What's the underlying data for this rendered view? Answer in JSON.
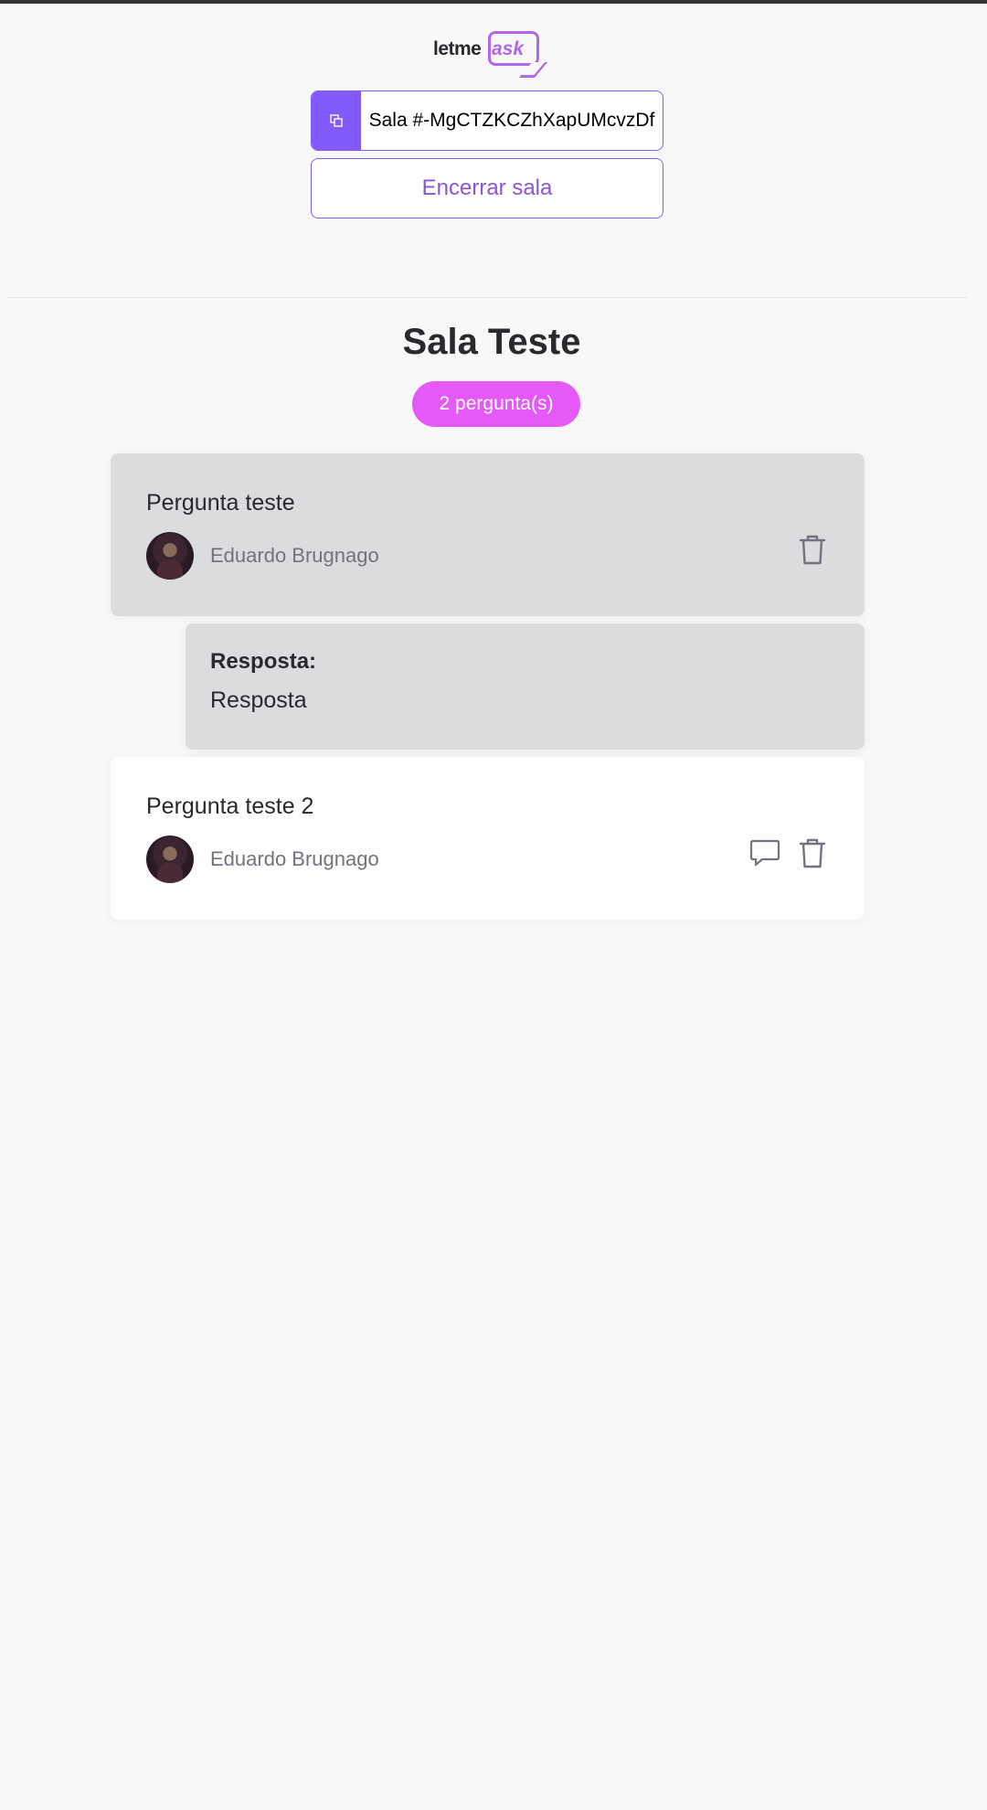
{
  "header": {
    "logo_text_1": "letme",
    "logo_text_2": "ask",
    "room_code": "Sala #-MgCTZKCZhXapUMcvzDf",
    "close_room_label": "Encerrar sala",
    "accent_color": "#835afd"
  },
  "room": {
    "title": "Sala Teste",
    "question_count": "2 pergunta(s)",
    "badge_color": "#e559f9"
  },
  "questions": [
    {
      "text": "Pergunta teste",
      "author": "Eduardo Brugnago",
      "answered": true,
      "answer_label": "Resposta:",
      "answer_text": "Resposta",
      "actions": [
        "trash-icon"
      ]
    },
    {
      "text": "Pergunta teste 2",
      "author": "Eduardo Brugnago",
      "answered": false,
      "actions": [
        "chat-icon",
        "trash-icon"
      ]
    }
  ]
}
